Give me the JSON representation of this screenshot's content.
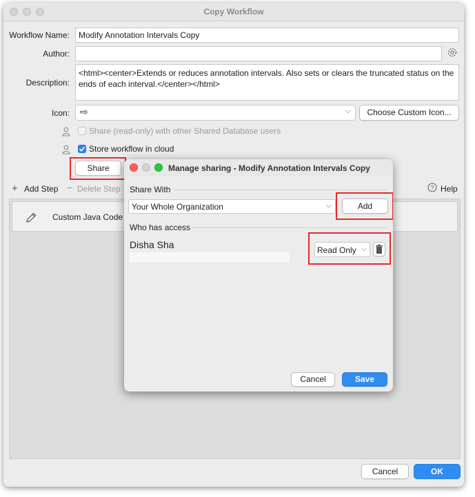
{
  "window": {
    "title": "Copy Workflow"
  },
  "form": {
    "workflow_name_label": "Workflow Name:",
    "workflow_name_value": "Modify Annotation Intervals Copy",
    "author_label": "Author:",
    "author_value": "",
    "description_label": "Description:",
    "description_value": "<html><center>Extends or reduces annotation intervals. Also sets or clears the truncated status on the ends of each interval.</center></html>",
    "icon_label": "Icon:",
    "icon_glyph": "⇨",
    "choose_icon_label": "Choose Custom Icon...",
    "share_readonly_label": "Share (read-only) with other Shared Database users",
    "store_cloud_label": "Store workflow in cloud",
    "share_button_label": "Share"
  },
  "toolbar": {
    "add_step_label": "Add Step",
    "delete_step_label": "Delete Step",
    "help_label": "Help"
  },
  "steps": [
    {
      "label": "Custom Java Code",
      "icon": "pencil-icon"
    }
  ],
  "footer": {
    "cancel_label": "Cancel",
    "ok_label": "OK"
  },
  "dialog": {
    "title": "Manage sharing - Modify Annotation Intervals Copy",
    "share_with_label": "Share With",
    "share_with_value": "Your Whole Organization",
    "add_label": "Add",
    "who_has_access_label": "Who has access",
    "user_name": "Disha Sha",
    "permission_value": "Read Only",
    "cancel_label": "Cancel",
    "save_label": "Save"
  },
  "colors": {
    "highlight": "#e42b2b",
    "primary": "#2f8cf0",
    "checkbox_checked": "#2f7ff0"
  }
}
